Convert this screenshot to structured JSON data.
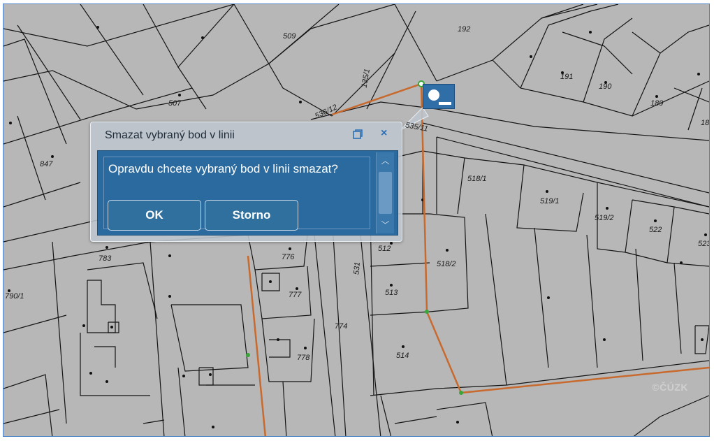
{
  "map": {
    "parcel_labels": [
      "192",
      "509",
      "191",
      "190",
      "189",
      "18",
      "507",
      "135/1",
      "536/12",
      "535/11",
      "847",
      "518/1",
      "519/1",
      "519/2",
      "522",
      "523",
      "783",
      "776",
      "512",
      "518/2",
      "790/1",
      "777",
      "513",
      "531",
      "774",
      "778",
      "514"
    ],
    "watermark": "©ČÚZK",
    "line_color": "#c86a2e",
    "vertex_color": "#3aa63a"
  },
  "dialog": {
    "title": "Smazat vybraný bod v linii",
    "message": "Opravdu chcete vybraný bod v linii smazat?",
    "ok_label": "OK",
    "cancel_label": "Storno",
    "close_glyph": "×",
    "scroll_up_glyph": "︿",
    "scroll_down_glyph": "﹀"
  },
  "colors": {
    "dialog_body": "#2b6a9e",
    "map_background": "#b7b7b7"
  }
}
